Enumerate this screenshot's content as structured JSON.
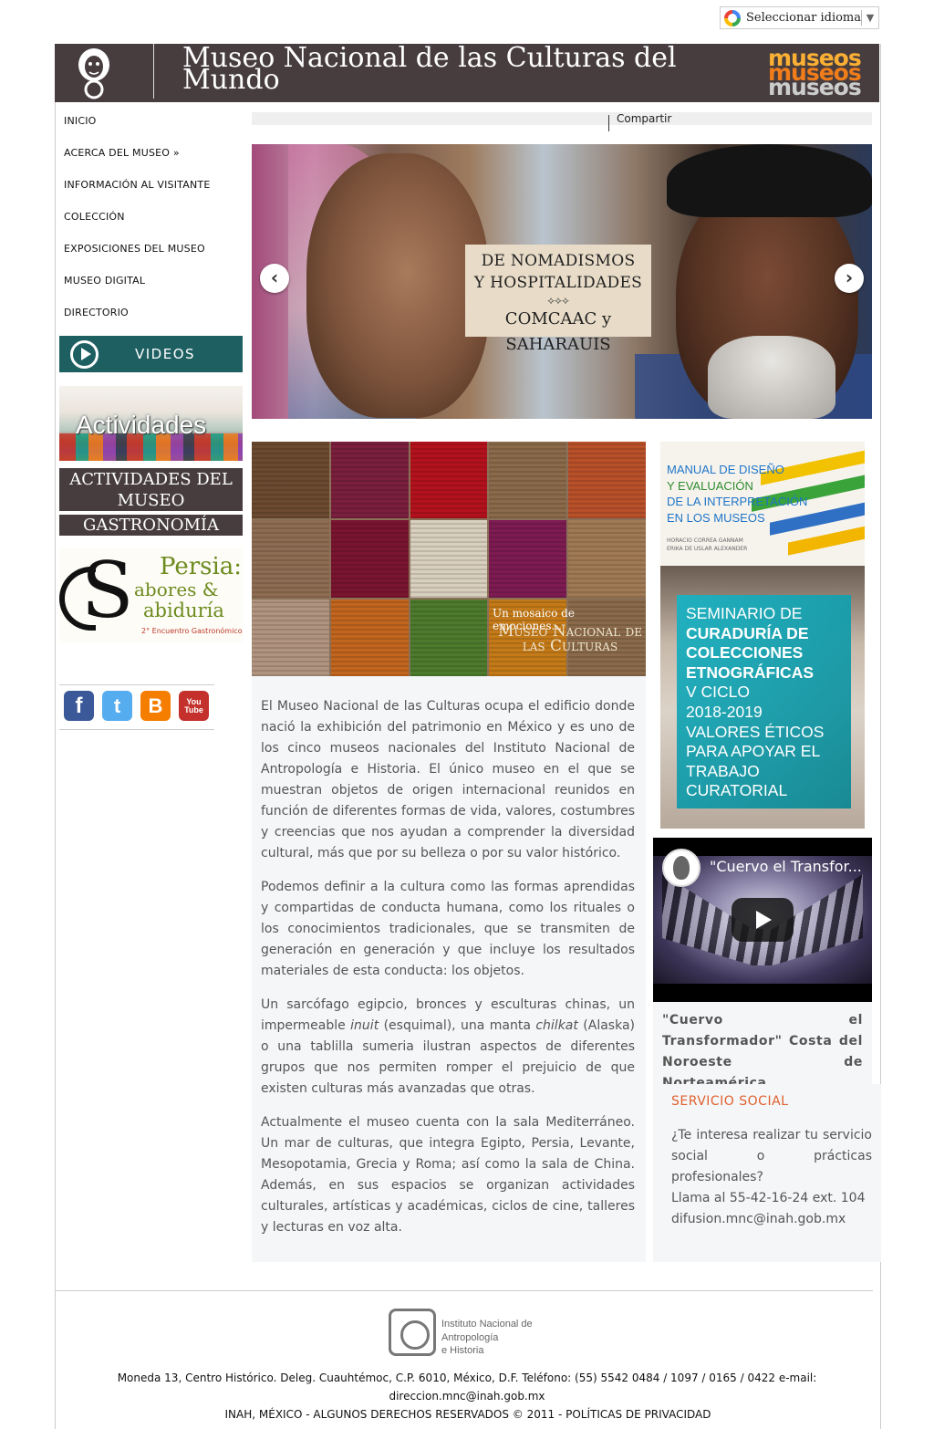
{
  "translate": {
    "label": "Seleccionar idioma",
    "arrow": "▼"
  },
  "header": {
    "title": "Museo Nacional de las Culturas del Mundo",
    "brand": "museos",
    "bg_color": "#473d3f"
  },
  "nav": {
    "items": [
      "INICIO",
      "ACERCA DEL MUSEO »",
      "INFORMACIÓN AL VISITANTE",
      "COLECCIÓN",
      "EXPOSICIONES DEL MUSEO",
      "MUSEO DIGITAL",
      "DIRECTORIO"
    ]
  },
  "sidebar": {
    "videos_label": "VIDEOS",
    "videos_color": "#1e5f62",
    "actividades_banner": "Actividades",
    "actividades_button": "ACTIVIDADES DEL MUSEO",
    "gastronomia_button": "GASTRONOMÍA",
    "persia": {
      "line1": "Persia:",
      "line2": "abores &",
      "line3": "abiduría",
      "line4": "2° Encuentro Gastronómico"
    },
    "social": [
      {
        "name": "facebook",
        "glyph": "f",
        "color": "#3b5998"
      },
      {
        "name": "twitter",
        "glyph": "t",
        "color": "#55acee"
      },
      {
        "name": "blogger",
        "glyph": "B",
        "color": "#f57d00"
      },
      {
        "name": "youtube",
        "glyph": "You Tube",
        "color": "#c4302b"
      }
    ]
  },
  "share": {
    "label": "Compartir"
  },
  "slider": {
    "line1": "DE NOMADISMOS",
    "line2": "Y HOSPITALIDADES",
    "line3": "COMCAAC y SAHARAUIS",
    "prev": "‹",
    "next": "›"
  },
  "mosaic": {
    "caption1": "Un mosaico de emociones...",
    "caption2": "Museo Nacional de las Culturas",
    "tiles": [
      "#6b4a2f",
      "#7a1f3d",
      "#b3121d",
      "#8a6a4a",
      "#b8502a",
      "#8e6c52",
      "#7a1530",
      "#d8cfbe",
      "#7d1b52",
      "#a07a55",
      "#b09480",
      "#c2651f",
      "#4d7a2c",
      "#c47a18",
      "#8a6a4a"
    ]
  },
  "main_text": [
    "El Museo Nacional de las Culturas ocupa el edificio donde nació la exhibición del patrimonio en México y es uno de los cinco museos nacionales del Instituto Nacional de Antropología e Historia. El único museo en el que se muestran objetos de origen internacional reunidos en función de diferentes formas de vida, valores, costumbres y creencias que nos ayudan a comprender la diversidad cultural, más que por su belleza o por su valor histórico.",
    "Podemos definir a la cultura como las formas aprendidas y compartidas de conducta humana, como los rituales o los conocimientos tradicionales, que se transmiten de generación en generación y que incluye los resultados materiales de esta conducta: los objetos.",
    "Un sarcófago egipcio, bronces y esculturas chinas, un impermeable inuit (esquimal), una manta chilkat (Alaska) o una tablilla sumeria ilustran aspectos de diferentes grupos que nos permiten romper el prejuicio de que existen culturas más avanzadas que otras.",
    "Actualmente el museo cuenta con la sala Mediterráneo. Un mar de culturas, que integra Egipto, Persia, Levante, Mesopotamia, Grecia y Roma; así como la sala de China. Además, en sus espacios se organizan actividades culturales, artísticas y académicas, ciclos de cine, talleres y lecturas en voz alta."
  ],
  "manual": {
    "line1": "MANUAL DE DISEÑO",
    "line2": "Y EVALUACIÓN",
    "line3": "DE LA INTERPRETACIÓN",
    "line4": "EN LOS MUSEOS",
    "author1": "HORACIO CORREA GANNAM",
    "author2": "ERIKA DE USLAR ALEXANDER"
  },
  "seminar": {
    "lines": [
      "SEMINARIO DE",
      "CURADURÍA DE",
      "COLECCIONES",
      "ETNOGRÁFICAS",
      "V CICLO",
      "2018-2019",
      "VALORES ÉTICOS",
      "PARA APOYAR EL",
      "TRABAJO",
      "CURATORIAL"
    ]
  },
  "video": {
    "title": "\"Cuervo el Transfor...",
    "caption": "\"Cuervo el Transformador\" Costa del Noroeste de Norteamérica"
  },
  "service": {
    "title": "SERVICIO SOCIAL",
    "line1": "¿Te interesa realizar tu servicio social o prácticas profesionales?",
    "line2": "Llama al 55-42-16-24 ext. 104",
    "line3": "difusion.mnc@inah.gob.mx",
    "title_color": "#e0602e"
  },
  "footer": {
    "inah_line1": "Instituto Nacional de",
    "inah_line2": "Antropología",
    "inah_line3": "e Historia",
    "address": "Moneda 13, Centro Histórico. Deleg. Cuauhtémoc, C.P. 6010, México, D.F. Teléfono: (55) 5542 0484 / 1097 / 0165 / 0422 e-mail: direccion.mnc@inah.gob.mx",
    "copyright": "INAH, MÉXICO - ALGUNOS DERECHOS RESERVADOS © 2011 - POLÍTICAS DE PRIVACIDAD"
  }
}
